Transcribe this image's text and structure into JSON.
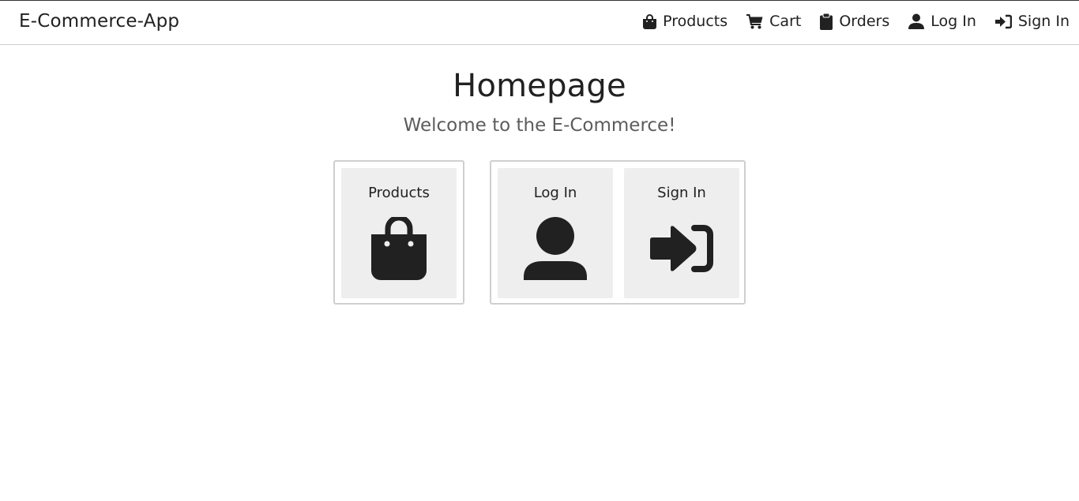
{
  "navbar": {
    "brand": "E-Commerce-App",
    "links": [
      {
        "label": "Products",
        "icon": "shopping-bag-icon"
      },
      {
        "label": "Cart",
        "icon": "shopping-cart-icon"
      },
      {
        "label": "Orders",
        "icon": "clipboard-icon"
      },
      {
        "label": "Log In",
        "icon": "user-icon"
      },
      {
        "label": "Sign In",
        "icon": "sign-in-icon"
      }
    ]
  },
  "main": {
    "title": "Homepage",
    "subtitle": "Welcome to the E-Commerce!",
    "cards": [
      {
        "label": "Products",
        "icon": "shopping-bag-icon"
      },
      {
        "label": "Log In",
        "icon": "user-icon"
      },
      {
        "label": "Sign In",
        "icon": "sign-in-icon"
      }
    ]
  },
  "colors": {
    "text": "#212121",
    "subtitle": "#5c5c5c",
    "card_background": "#eeeeee",
    "border": "#cfcfcf"
  }
}
